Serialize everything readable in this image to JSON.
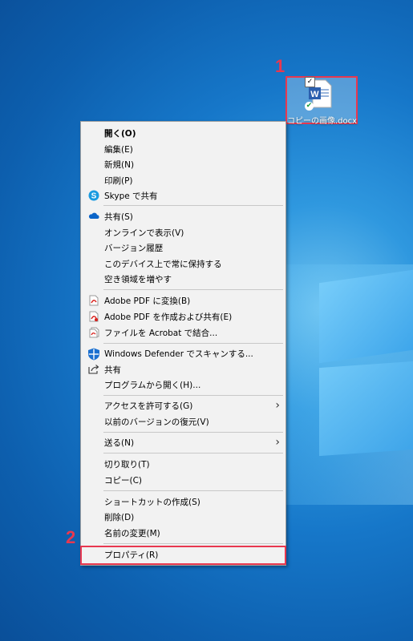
{
  "desktop": {
    "icon_label": "コピーの画像.docx",
    "doc_letter": "W"
  },
  "badges": {
    "one": "1",
    "two": "2"
  },
  "accent": "#e8384f",
  "menu": {
    "open": "開く(O)",
    "edit": "編集(E)",
    "new": "新規(N)",
    "print": "印刷(P)",
    "skype": "Skype で共有",
    "share_onedrive": "共有(S)",
    "view_online": "オンラインで表示(V)",
    "version_history": "バージョン履歴",
    "keep_on_device": "このデバイス上で常に保持する",
    "free_space": "空き領域を増やす",
    "pdf_convert": "Adobe PDF に変換(B)",
    "pdf_share": "Adobe PDF を作成および共有(E)",
    "acrobat_combine": "ファイルを Acrobat で結合...",
    "defender": "Windows Defender でスキャンする...",
    "share": "共有",
    "open_with": "プログラムから開く(H)...",
    "give_access": "アクセスを許可する(G)",
    "restore_versions": "以前のバージョンの復元(V)",
    "send_to": "送る(N)",
    "cut": "切り取り(T)",
    "copy": "コピー(C)",
    "create_shortcut": "ショートカットの作成(S)",
    "delete": "削除(D)",
    "rename": "名前の変更(M)",
    "properties": "プロパティ(R)"
  }
}
